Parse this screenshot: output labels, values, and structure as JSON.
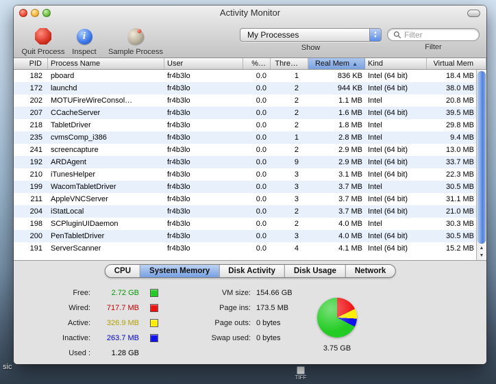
{
  "window": {
    "title": "Activity Monitor"
  },
  "toolbar": {
    "buttons": [
      {
        "label": "Quit Process"
      },
      {
        "label": "Inspect"
      },
      {
        "label": "Sample Process"
      }
    ],
    "show": {
      "label": "Show",
      "selected": "My Processes"
    },
    "filter": {
      "label": "Filter",
      "placeholder": "Filter"
    }
  },
  "table": {
    "sort_indicator": "▲",
    "columns": [
      {
        "key": "pid",
        "label": "PID",
        "sorted": false
      },
      {
        "key": "name",
        "label": "Process Name",
        "sorted": false
      },
      {
        "key": "user",
        "label": "User",
        "sorted": false
      },
      {
        "key": "cpu",
        "label": "%…",
        "sorted": false
      },
      {
        "key": "threads",
        "label": "Thre…",
        "sorted": false
      },
      {
        "key": "realmem",
        "label": "Real Mem",
        "sorted": true
      },
      {
        "key": "kind",
        "label": "Kind",
        "sorted": false
      },
      {
        "key": "vmem",
        "label": "Virtual Mem",
        "sorted": false
      }
    ],
    "rows": [
      {
        "pid": "182",
        "name": "pboard",
        "user": "fr4b3lo",
        "cpu": "0.0",
        "threads": "1",
        "realmem": "836 KB",
        "kind": "Intel (64 bit)",
        "vmem": "18.4 MB"
      },
      {
        "pid": "172",
        "name": "launchd",
        "user": "fr4b3lo",
        "cpu": "0.0",
        "threads": "2",
        "realmem": "944 KB",
        "kind": "Intel (64 bit)",
        "vmem": "38.0 MB"
      },
      {
        "pid": "202",
        "name": "MOTUFireWireConsol…",
        "user": "fr4b3lo",
        "cpu": "0.0",
        "threads": "2",
        "realmem": "1.1 MB",
        "kind": "Intel",
        "vmem": "20.8 MB"
      },
      {
        "pid": "207",
        "name": "CCacheServer",
        "user": "fr4b3lo",
        "cpu": "0.0",
        "threads": "2",
        "realmem": "1.6 MB",
        "kind": "Intel (64 bit)",
        "vmem": "39.5 MB"
      },
      {
        "pid": "218",
        "name": "TabletDriver",
        "user": "fr4b3lo",
        "cpu": "0.0",
        "threads": "2",
        "realmem": "1.8 MB",
        "kind": "Intel",
        "vmem": "29.8 MB"
      },
      {
        "pid": "235",
        "name": "cvmsComp_i386",
        "user": "fr4b3lo",
        "cpu": "0.0",
        "threads": "1",
        "realmem": "2.8 MB",
        "kind": "Intel",
        "vmem": "9.4 MB"
      },
      {
        "pid": "241",
        "name": "screencapture",
        "user": "fr4b3lo",
        "cpu": "0.0",
        "threads": "2",
        "realmem": "2.9 MB",
        "kind": "Intel (64 bit)",
        "vmem": "13.0 MB"
      },
      {
        "pid": "192",
        "name": "ARDAgent",
        "user": "fr4b3lo",
        "cpu": "0.0",
        "threads": "9",
        "realmem": "2.9 MB",
        "kind": "Intel (64 bit)",
        "vmem": "33.7 MB"
      },
      {
        "pid": "210",
        "name": "iTunesHelper",
        "user": "fr4b3lo",
        "cpu": "0.0",
        "threads": "3",
        "realmem": "3.1 MB",
        "kind": "Intel (64 bit)",
        "vmem": "22.3 MB"
      },
      {
        "pid": "199",
        "name": "WacomTabletDriver",
        "user": "fr4b3lo",
        "cpu": "0.0",
        "threads": "3",
        "realmem": "3.7 MB",
        "kind": "Intel",
        "vmem": "30.5 MB"
      },
      {
        "pid": "211",
        "name": "AppleVNCServer",
        "user": "fr4b3lo",
        "cpu": "0.0",
        "threads": "3",
        "realmem": "3.7 MB",
        "kind": "Intel (64 bit)",
        "vmem": "31.1 MB"
      },
      {
        "pid": "204",
        "name": "iStatLocal",
        "user": "fr4b3lo",
        "cpu": "0.0",
        "threads": "2",
        "realmem": "3.7 MB",
        "kind": "Intel (64 bit)",
        "vmem": "21.0 MB"
      },
      {
        "pid": "198",
        "name": "SCPluginUIDaemon",
        "user": "fr4b3lo",
        "cpu": "0.0",
        "threads": "2",
        "realmem": "4.0 MB",
        "kind": "Intel",
        "vmem": "30.3 MB"
      },
      {
        "pid": "200",
        "name": "PenTabletDriver",
        "user": "fr4b3lo",
        "cpu": "0.0",
        "threads": "3",
        "realmem": "4.0 MB",
        "kind": "Intel (64 bit)",
        "vmem": "30.5 MB"
      },
      {
        "pid": "191",
        "name": "ServerScanner",
        "user": "fr4b3lo",
        "cpu": "0.0",
        "threads": "4",
        "realmem": "4.1 MB",
        "kind": "Intel (64 bit)",
        "vmem": "15.2 MB"
      }
    ]
  },
  "tabs": [
    {
      "label": "CPU",
      "selected": false
    },
    {
      "label": "System Memory",
      "selected": true
    },
    {
      "label": "Disk Activity",
      "selected": false
    },
    {
      "label": "Disk Usage",
      "selected": false
    },
    {
      "label": "Network",
      "selected": false
    }
  ],
  "memory": {
    "stats": [
      {
        "label": "Free:",
        "value": "2.72 GB",
        "text_color": "#009b00",
        "swatch": "#22cc22"
      },
      {
        "label": "Wired:",
        "value": "717.7 MB",
        "text_color": "#c00000",
        "swatch": "#ee1111"
      },
      {
        "label": "Active:",
        "value": "326.9 MB",
        "text_color": "#b1a000",
        "swatch": "#ffee00"
      },
      {
        "label": "Inactive:",
        "value": "263.7 MB",
        "text_color": "#0000cc",
        "swatch": "#1111ee"
      },
      {
        "label": "Used :",
        "value": "1.28 GB",
        "text_color": "#000000",
        "swatch": null
      }
    ],
    "vm_stats": [
      {
        "label": "VM size:",
        "value": "154.66 GB"
      },
      {
        "label": "Page ins:",
        "value": "173.5 MB"
      },
      {
        "label": "Page outs:",
        "value": "0 bytes"
      },
      {
        "label": "Swap used:",
        "value": "0 bytes"
      }
    ],
    "pie": {
      "total_label": "3.75 GB",
      "slices": [
        {
          "name": "wired",
          "color": "#ee1111",
          "sweep_deg": 64
        },
        {
          "name": "active",
          "color": "#ffee00",
          "sweep_deg": 29
        },
        {
          "name": "inactive",
          "color": "#1111ee",
          "sweep_deg": 24
        },
        {
          "name": "free",
          "color": "#22cc22",
          "sweep_deg": 243
        }
      ]
    }
  },
  "desktop": {
    "partial_label": "sic",
    "icon_label": "TIFF"
  }
}
